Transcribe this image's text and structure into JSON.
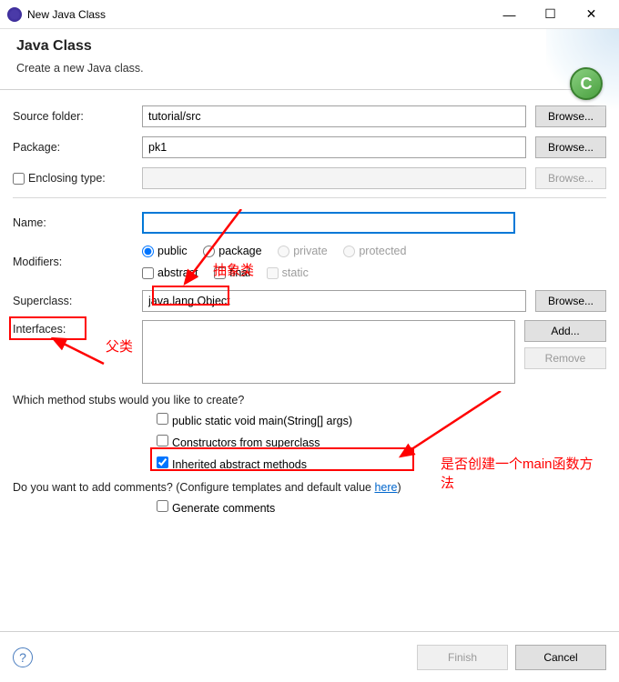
{
  "titlebar": {
    "title": "New Java Class"
  },
  "header": {
    "title": "Java Class",
    "desc": "Create a new Java class.",
    "badge": "C"
  },
  "fields": {
    "source_folder_label": "Source folder:",
    "source_folder_value": "tutorial/src",
    "package_label": "Package:",
    "package_value": "pk1",
    "enclosing_label": "Enclosing type:",
    "enclosing_value": "",
    "name_label": "Name:",
    "name_value": "",
    "modifiers_label": "Modifiers:",
    "superclass_label": "Superclass:",
    "superclass_value": "java.lang.Object",
    "interfaces_label": "Interfaces:"
  },
  "buttons": {
    "browse": "Browse...",
    "add": "Add...",
    "remove": "Remove",
    "finish": "Finish",
    "cancel": "Cancel"
  },
  "modifiers": {
    "public": "public",
    "package": "package",
    "private": "private",
    "protected": "protected",
    "abstract": "abstract",
    "final": "final",
    "static": "static"
  },
  "questions": {
    "stubs": "Which method stubs would you like to create?",
    "comments": "Do you want to add comments? (Configure templates and default value ",
    "here": "here",
    "paren": ")"
  },
  "stubs": {
    "main": "public static void main(String[] args)",
    "ctors": "Constructors from superclass",
    "inherited": "Inherited abstract methods",
    "gencom": "Generate comments"
  },
  "annotations": {
    "abstract_class": "抽象类",
    "parent_class": "父类",
    "main_method": "是否创建一个main函数方法"
  }
}
